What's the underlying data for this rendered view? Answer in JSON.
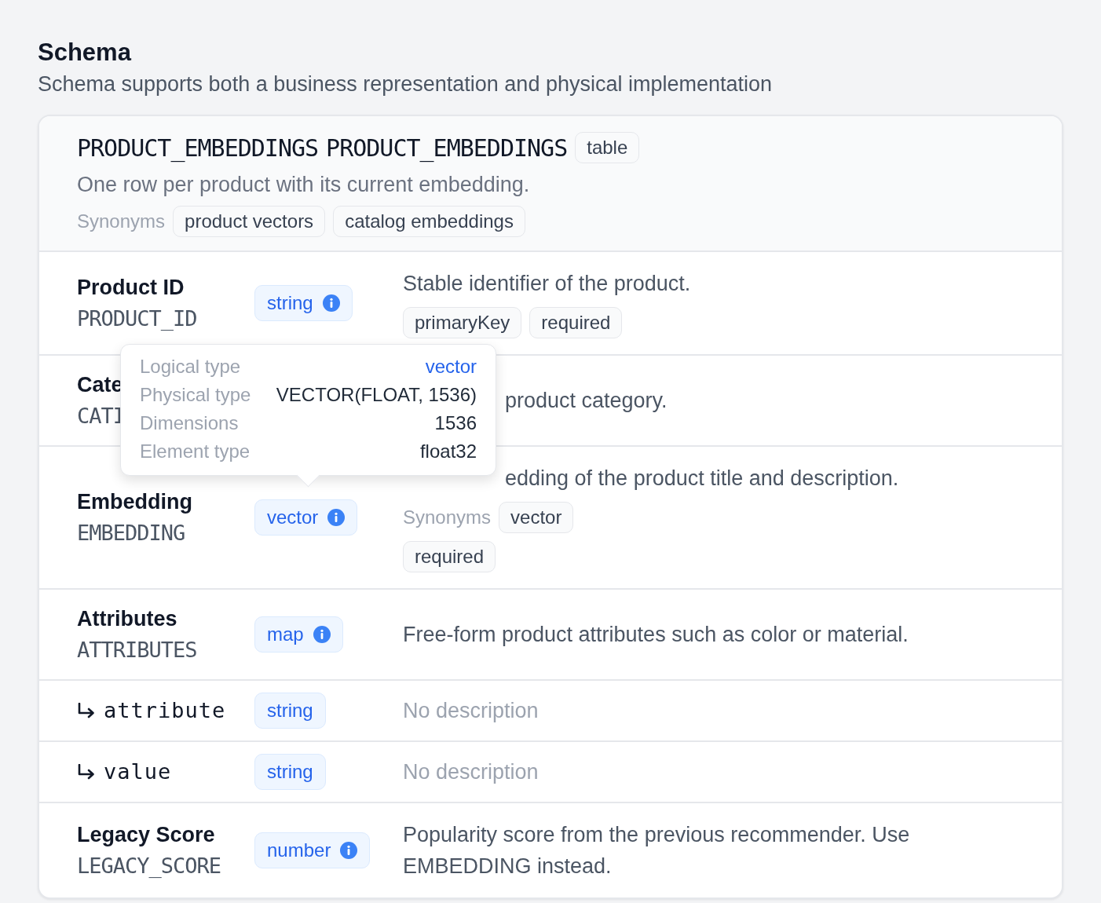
{
  "section": {
    "title": "Schema",
    "subtitle": "Schema supports both a business representation and physical implementation"
  },
  "table": {
    "name": "PRODUCT_EMBEDDINGS",
    "physical_name": "PRODUCT_EMBEDDINGS",
    "type_badge": "table",
    "description": "One row per product with its current embedding.",
    "synonyms_label": "Synonyms",
    "synonyms": [
      "product vectors",
      "catalog embeddings"
    ]
  },
  "fields": [
    {
      "kind": "field",
      "label": "Product ID",
      "column": "PRODUCT_ID",
      "type": "string",
      "info": true,
      "description": "Stable identifier of the product.",
      "tags": [
        "primaryKey",
        "required"
      ]
    },
    {
      "kind": "field",
      "label": "Cate",
      "column": "CATI",
      "description": "product category.",
      "obscured": true
    },
    {
      "kind": "field",
      "label": "Embedding",
      "column": "EMBEDDING",
      "type": "vector",
      "info": true,
      "description": "edding of the product title and description.",
      "obscured": true,
      "synonyms_label": "Synonyms",
      "synonyms": [
        "vector"
      ],
      "tags": [
        "required"
      ]
    },
    {
      "kind": "field",
      "label": "Attributes",
      "column": "ATTRIBUTES",
      "type": "map",
      "info": true,
      "description": "Free-form product attributes such as color or material."
    },
    {
      "kind": "subfield",
      "column": "attribute",
      "type": "string",
      "description": "No description",
      "description_missing": true
    },
    {
      "kind": "subfield",
      "column": "value",
      "type": "string",
      "description": "No description",
      "description_missing": true
    },
    {
      "kind": "field",
      "label": "Legacy Score",
      "column": "LEGACY_SCORE",
      "type": "number",
      "info": true,
      "description": "Popularity score from the previous recommender. Use EMBEDDING instead."
    }
  ],
  "tooltip": {
    "rows": [
      {
        "label": "Logical type",
        "value": "vector",
        "kind": "link"
      },
      {
        "label": "Physical type",
        "value": "VECTOR(FLOAT, 1536)",
        "kind": "text"
      },
      {
        "label": "Dimensions",
        "value": "1536",
        "kind": "text"
      },
      {
        "label": "Element type",
        "value": "float32",
        "kind": "text"
      }
    ]
  }
}
